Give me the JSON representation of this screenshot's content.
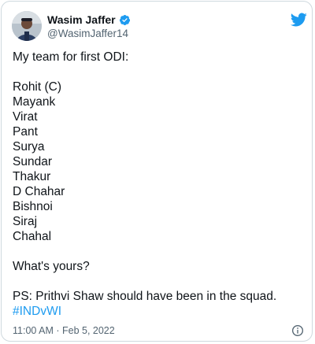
{
  "author": {
    "name": "Wasim Jaffer",
    "handle": "@WasimJaffer14"
  },
  "tweet": {
    "intro": "My team for first ODI:",
    "players": [
      "Rohit (C)",
      "Mayank",
      "Virat",
      "Pant",
      "Surya",
      "Sundar",
      "Thakur",
      "D Chahar",
      "Bishnoi",
      "Siraj",
      "Chahal"
    ],
    "question": "What's yours?",
    "ps": "PS: Prithvi Shaw should have been in the squad.",
    "hashtag": "#INDvWI"
  },
  "timestamp": "11:00 AM · Feb 5, 2022",
  "icons": {
    "verified": "verified-badge-icon",
    "platform": "twitter-bird-icon",
    "info": "info-icon"
  },
  "colors": {
    "accent": "#1d9bf0",
    "text": "#0f1419",
    "muted": "#536471",
    "border": "#cfd9de"
  }
}
